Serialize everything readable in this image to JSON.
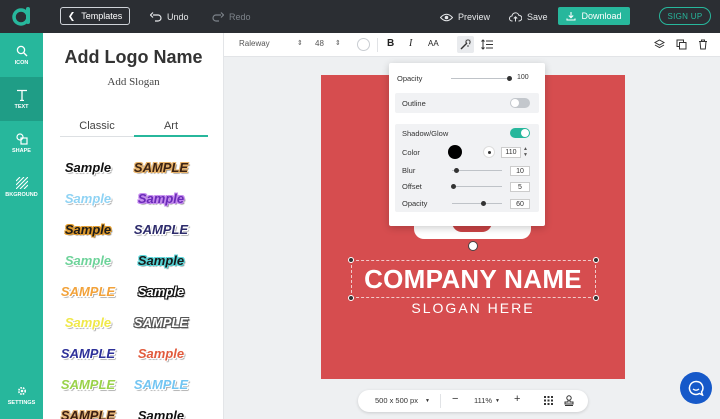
{
  "topbar": {
    "templates_label": "Templates",
    "undo_label": "Undo",
    "redo_label": "Redo",
    "preview_label": "Preview",
    "save_label": "Save",
    "download_label": "Download",
    "signup_label": "SIGN UP"
  },
  "rail": {
    "items": [
      {
        "label": "ICON",
        "icon": "search-icon"
      },
      {
        "label": "TEXT",
        "icon": "text-icon"
      },
      {
        "label": "SHAPE",
        "icon": "shape-icon"
      },
      {
        "label": "BKGROUND",
        "icon": "background-icon"
      },
      {
        "label": "SETTINGS",
        "icon": "gear-icon"
      }
    ]
  },
  "panel": {
    "title": "Add Logo Name",
    "subtitle": "Add Slogan",
    "tabs": [
      "Classic",
      "Art"
    ],
    "active_tab": "Art",
    "samples": [
      {
        "text": "Sample",
        "color": "#111111",
        "stroke": "#ffffff"
      },
      {
        "text": "SAMPLE",
        "color": "#3b2314",
        "stroke": "#e8b36a"
      },
      {
        "text": "Sample",
        "color": "#8fd3f4",
        "stroke": "#ffffff"
      },
      {
        "text": "Sample",
        "color": "#6a2bb8",
        "stroke": "#c58bef"
      },
      {
        "text": "Sample",
        "color": "#1b1b1b",
        "stroke": "#e09a2a"
      },
      {
        "text": "SAMPLE",
        "color": "#2d2b6b",
        "stroke": "#ffffff"
      },
      {
        "text": "Sample",
        "color": "#6ed39a",
        "stroke": "#ffffff"
      },
      {
        "text": "Sample",
        "color": "#1a1a1a",
        "stroke": "#55d5d8"
      },
      {
        "text": "SAMPLE",
        "color": "#f2a23a",
        "stroke": "#ffffff"
      },
      {
        "text": "Sample",
        "color": "#ffffff",
        "stroke": "#111111"
      },
      {
        "text": "Sample",
        "color": "#f0e84a",
        "stroke": "#ffffff"
      },
      {
        "text": "SAMPLE",
        "color": "#ffffff",
        "stroke": "#555555"
      },
      {
        "text": "SAMPLE",
        "color": "#2e3199",
        "stroke": "#ffffff"
      },
      {
        "text": "Sample",
        "color": "#e15b3d",
        "stroke": "#ffffff"
      },
      {
        "text": "SAMPLE",
        "color": "#9ad24a",
        "stroke": "#ffffff"
      },
      {
        "text": "SAMPLE",
        "color": "#73c5f2",
        "stroke": "#ffffff"
      },
      {
        "text": "SAMPLE",
        "color": "#3a1d12",
        "stroke": "#e6b77a"
      },
      {
        "text": "Sample",
        "color": "#111111",
        "stroke": "#ffffff"
      }
    ]
  },
  "toolbar": {
    "font": "Raleway",
    "size": "48",
    "bold": "B",
    "italic": "I",
    "case": "AA"
  },
  "effects": {
    "opacity_label": "Opacity",
    "opacity_value": "100",
    "outline_label": "Outline",
    "shadow_label": "Shadow/Glow",
    "color_label": "Color",
    "color_value": "110",
    "blur_label": "Blur",
    "blur_value": "10",
    "offset_label": "Offset",
    "offset_value": "5",
    "shadow_opacity_label": "Opacity",
    "shadow_opacity_value": "60"
  },
  "canvas": {
    "company": "COMPANY NAME",
    "slogan": "SLOGAN HERE",
    "background": "#d64d4f"
  },
  "zoombar": {
    "size": "500 x 500 px",
    "zoom": "111%"
  },
  "colors": {
    "accent": "#27b79c",
    "topbar": "#2b2e33",
    "chat": "#1659c9"
  }
}
